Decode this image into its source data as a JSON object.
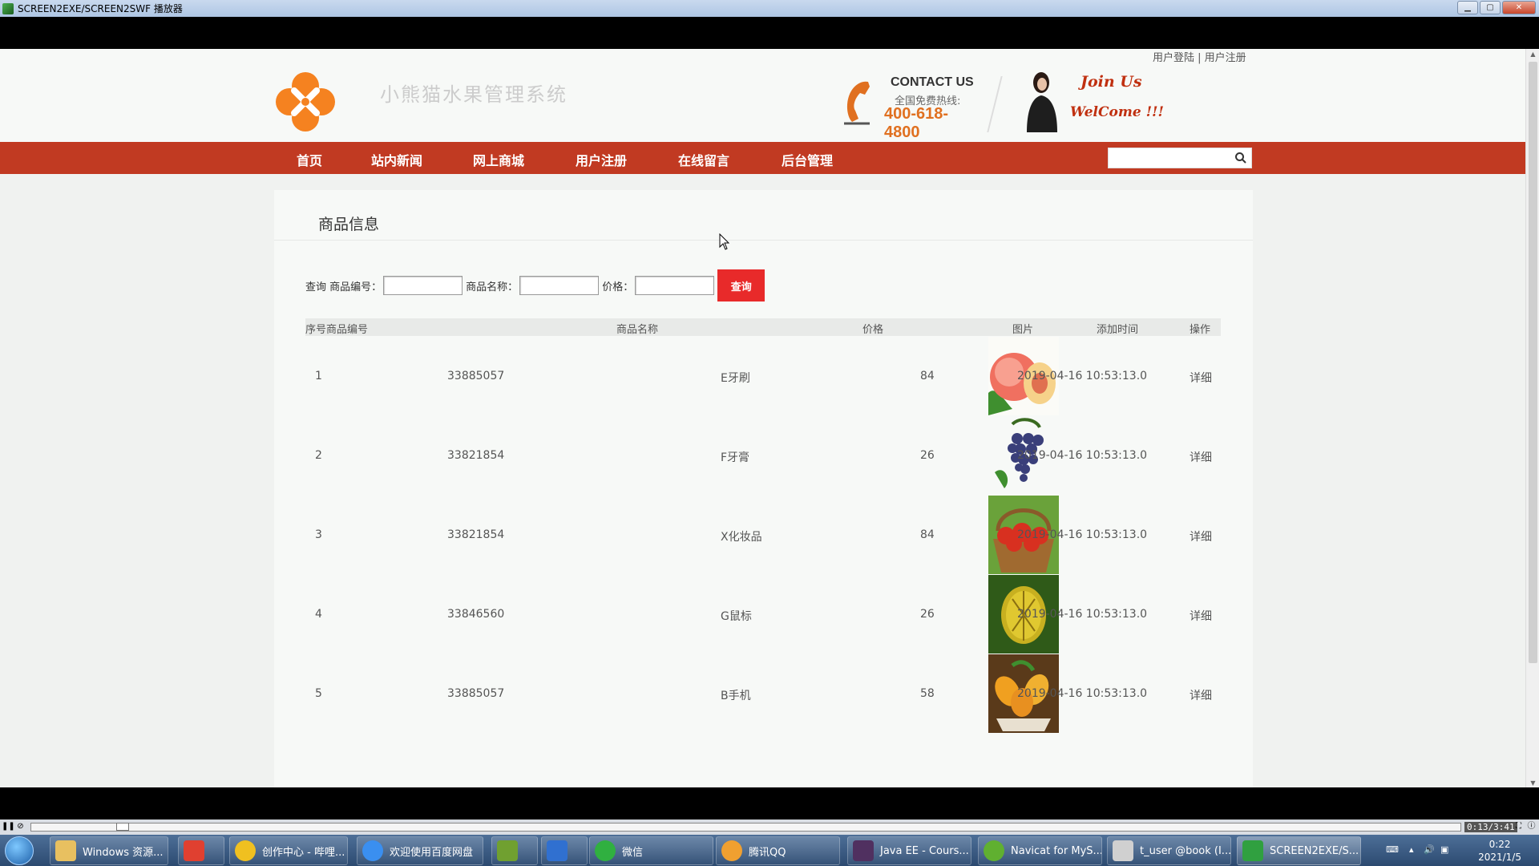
{
  "window": {
    "title": "SCREEN2EXE/SCREEN2SWF 播放器"
  },
  "header": {
    "top_links": {
      "login": "用户登陆",
      "sep": " | ",
      "register": "用户注册"
    },
    "site_title": "小熊猫水果管理系统",
    "contact_title": "CONTACT US",
    "hotline_label": "全国免费热线:",
    "hotline": "400-618-4800",
    "join": "Join Us",
    "welcome": "WelCome !!!"
  },
  "nav": {
    "items": [
      "首页",
      "站内新闻",
      "网上商城",
      "用户注册",
      "在线留言",
      "后台管理"
    ],
    "search_placeholder": ""
  },
  "content": {
    "title": "商品信息",
    "query": {
      "label": "查询",
      "code_label": "商品编号：",
      "name_label": "商品名称：",
      "price_label": "价格：",
      "button": "查询"
    },
    "table": {
      "headers": [
        "序号",
        "商品编号",
        "商品名称",
        "价格",
        "图片",
        "添加时间",
        "操作"
      ],
      "rows": [
        {
          "no": "1",
          "code": "33885057",
          "name": "E牙刷",
          "price": "84",
          "image": "peach",
          "time": "2019-04-16 10:53:13.0",
          "action": "详细"
        },
        {
          "no": "2",
          "code": "33821854",
          "name": "F牙膏",
          "price": "26",
          "image": "grapes",
          "time": "2019-04-16 10:53:13.0",
          "action": "详细"
        },
        {
          "no": "3",
          "code": "33821854",
          "name": "X化妆品",
          "price": "84",
          "image": "apple-basket",
          "time": "2019-04-16 10:53:13.0",
          "action": "详细"
        },
        {
          "no": "4",
          "code": "33846560",
          "name": "G鼠标",
          "price": "26",
          "image": "durian",
          "time": "2019-04-16 10:53:13.0",
          "action": "详细"
        },
        {
          "no": "5",
          "code": "33885057",
          "name": "B手机",
          "price": "58",
          "image": "mango",
          "time": "2019-04-16 10:53:13.0",
          "action": "详细"
        }
      ]
    }
  },
  "player": {
    "time": "0:13/3:41",
    "progress": 0.06
  },
  "taskbar": {
    "items": [
      {
        "label": "Windows 资源...",
        "color": "#e8c060"
      },
      {
        "label": "",
        "color": "#e04030"
      },
      {
        "label": "创作中心 - 哔哩...",
        "color": "#f0c020"
      },
      {
        "label": "欢迎使用百度网盘",
        "color": "#3a8ff0"
      },
      {
        "label": "",
        "color": "#70a030"
      },
      {
        "label": "",
        "color": "#3070d0"
      },
      {
        "label": "微信",
        "color": "#30b040"
      },
      {
        "label": "腾讯QQ",
        "color": "#f0a030"
      },
      {
        "label": "Java EE - Cours...",
        "color": "#503060"
      },
      {
        "label": "Navicat for MyS...",
        "color": "#60b030"
      },
      {
        "label": "t_user @book (I...",
        "color": "#d0d0d0"
      },
      {
        "label": "SCREEN2EXE/S...",
        "color": "#30a040"
      }
    ],
    "clock_time": "0:22",
    "clock_date": "2021/1/5"
  }
}
